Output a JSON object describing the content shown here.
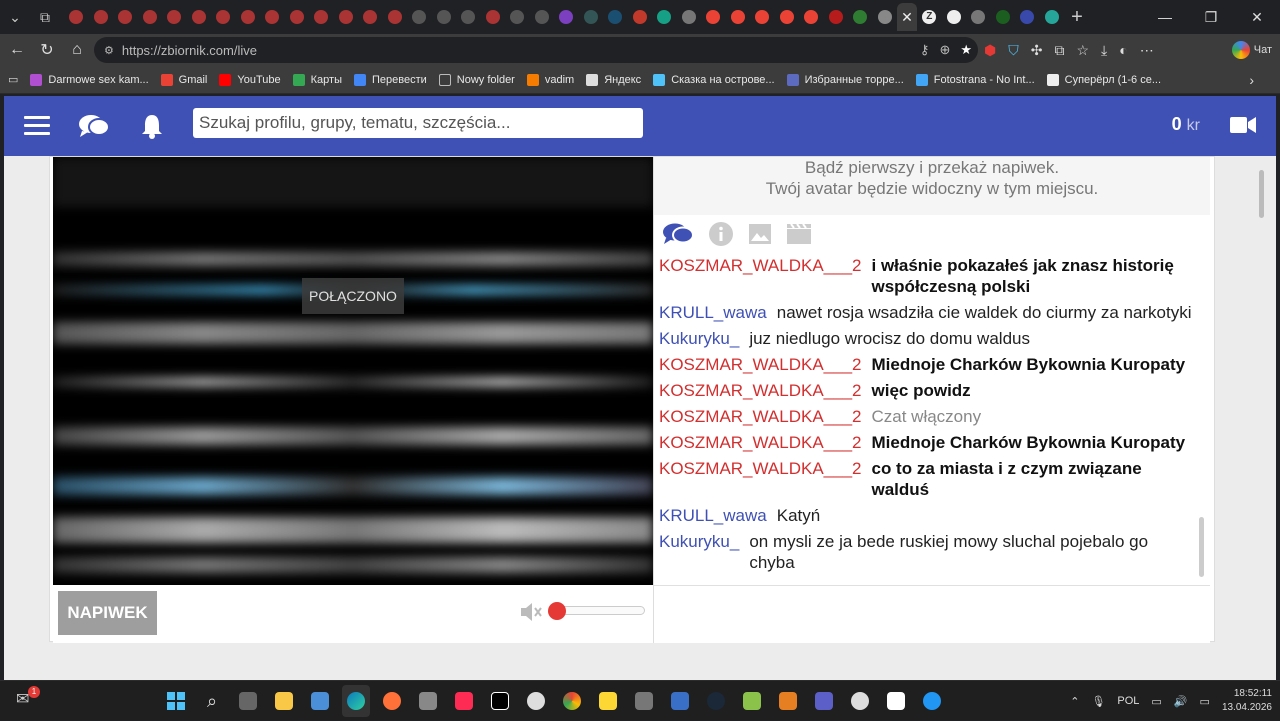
{
  "browser": {
    "url": "https://zbiornik.com/live",
    "active_tab_icon": "Z",
    "new_tab": "+",
    "chat_label": "Чат",
    "window_controls": [
      "minimize-icon",
      "maximize-icon",
      "close-icon"
    ]
  },
  "bookmarks": [
    {
      "label": "Darmowe sex kam...",
      "color": "#b04fcf"
    },
    {
      "label": "Gmail",
      "color": "#ea4335"
    },
    {
      "label": "YouTube",
      "color": "#ff0000"
    },
    {
      "label": "Карты",
      "color": "#34a853"
    },
    {
      "label": "Перевести",
      "color": "#4285f4"
    },
    {
      "label": "Nowy folder",
      "color": "#bbbbbb"
    },
    {
      "label": "vadim",
      "color": "#f57c00"
    },
    {
      "label": "Яндекс",
      "color": "#dddddd"
    },
    {
      "label": "Сказка на острове...",
      "color": "#4fc3f7"
    },
    {
      "label": "Избранные торре...",
      "color": "#5c6bc0"
    },
    {
      "label": "Fotostrana - No Int...",
      "color": "#42a5f5"
    },
    {
      "label": "Суперёрл (1-6 се...",
      "color": "#eeeeee"
    }
  ],
  "header": {
    "search_placeholder": "Szukaj profilu, grupy, tematu, szczęścia...",
    "credits_value": "0",
    "credits_unit": "kr",
    "accent": "#3f51b5"
  },
  "video": {
    "status": "POŁĄCZONO",
    "tip_button": "NAPIWEK",
    "volume": 0
  },
  "chat": {
    "tip_line1": "Bądź pierwszy i przekaż napiwek.",
    "tip_line2": "Twój avatar będzie widoczny w tym miejscu.",
    "messages": [
      {
        "user": "KOSZMAR_WALDKA___2",
        "text": "i właśnie pokazałeś jak znasz historię współczesną polski"
      },
      {
        "user": "KRULL_wawa",
        "text": "nawet rosja wsadziła cie waldek do ciurmy za narkotyki"
      },
      {
        "user": "Kukuryku_",
        "text": "juz niedlugo wrocisz do domu waldus"
      },
      {
        "user": "KOSZMAR_WALDKA___2",
        "text": "Miednoje Charków Bykownia Kuropaty"
      },
      {
        "user": "KOSZMAR_WALDKA___2",
        "text": "więc powidz"
      },
      {
        "user": "KOSZMAR_WALDKA___2",
        "text": "Czat włączony"
      },
      {
        "user": "KOSZMAR_WALDKA___2",
        "text": "Miednoje Charków Bykownia Kuropaty"
      },
      {
        "user": "KOSZMAR_WALDKA___2",
        "text": "co to za miasta i z czym związane walduś"
      },
      {
        "user": "KRULL_wawa",
        "text": "Katyń"
      },
      {
        "user": "Kukuryku_",
        "text": "on mysli ze ja bede ruskiej mowy sluchal pojebalo go chyba"
      }
    ]
  },
  "taskbar": {
    "notification_count": "1",
    "language": "POL",
    "time": "18:52:11",
    "date": "13.04.2026"
  }
}
